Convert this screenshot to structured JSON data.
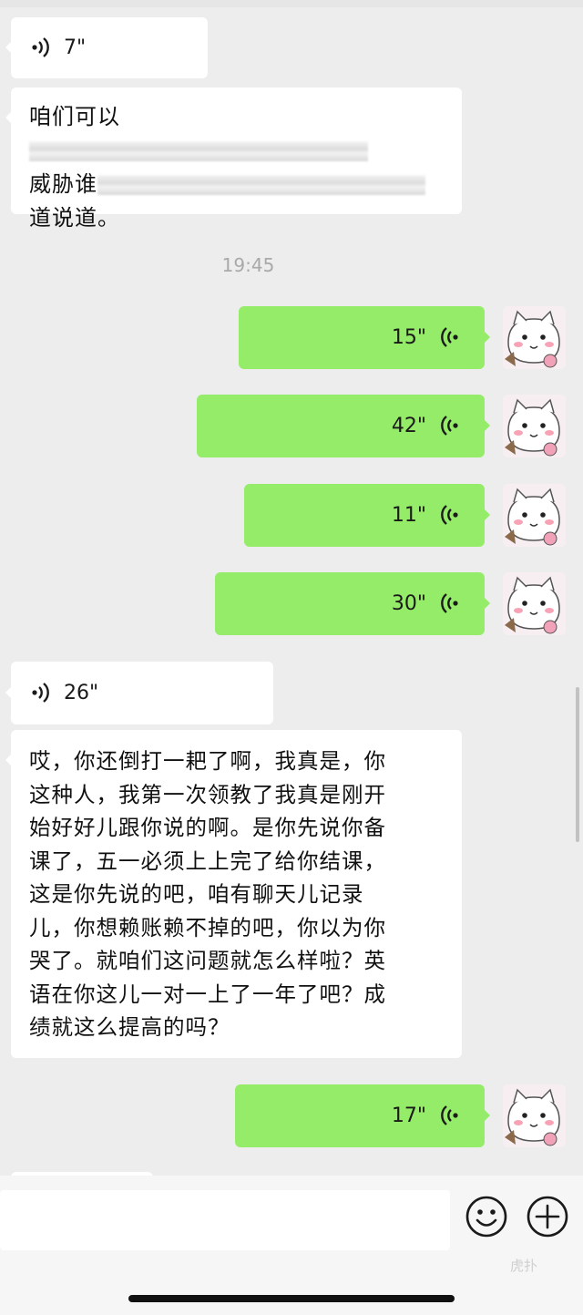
{
  "chat": {
    "incoming_voice_1": {
      "duration": "7\""
    },
    "incoming_text_1": {
      "line1": "咱们可以",
      "line2": "威胁谁",
      "line3": "道说道。"
    },
    "timestamp": "19:45",
    "outgoing_voice": [
      {
        "duration": "15\""
      },
      {
        "duration": "42\""
      },
      {
        "duration": "11\""
      },
      {
        "duration": "30\""
      },
      {
        "duration": "17\""
      }
    ],
    "incoming_voice_2": {
      "duration": "26\""
    },
    "incoming_text_2": {
      "lines": [
        "哎，你还倒打一耙了啊，我真是，你",
        "这种人，我第一次领教了我真是刚开",
        "始好好儿跟你说的啊。是你先说你备",
        "课了，五一必须上上完了给你结课，",
        "这是你先说的吧，咱有聊天儿记录",
        "儿，你想赖账赖不掉的吧，你以为你",
        "哭了。就咱们这问题就怎么样啦？英",
        "语在你这儿一对一上了一年了吧？成",
        "绩就这么提高的吗？"
      ]
    }
  },
  "input": {
    "value": "",
    "emoji_icon": "smiley-face-icon",
    "more_icon": "plus-circle-icon"
  },
  "watermark": "虎扑",
  "colors": {
    "background": "#ededed",
    "incoming_bubble": "#ffffff",
    "outgoing_bubble": "#95ec69",
    "timestamp": "#a9a9a9"
  }
}
